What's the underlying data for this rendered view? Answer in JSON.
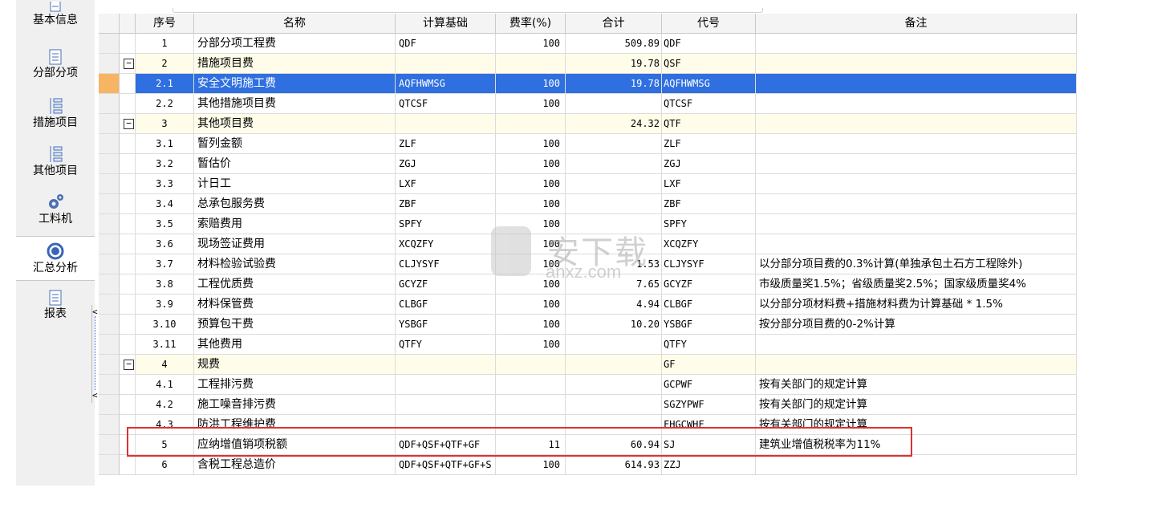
{
  "sidebar": {
    "items": [
      {
        "label": "基本信息",
        "icon": "document-icon"
      },
      {
        "label": "分部分项",
        "icon": "list-icon"
      },
      {
        "label": "措施项目",
        "icon": "tree-icon"
      },
      {
        "label": "其他项目",
        "icon": "tree-icon"
      },
      {
        "label": "工料机",
        "icon": "gears-icon"
      },
      {
        "label": "汇总分析",
        "icon": "circle-icon"
      },
      {
        "label": "报表",
        "icon": "report-icon"
      }
    ],
    "active": "汇总分析",
    "collapse_arrow": "<"
  },
  "columns": {
    "seq": "序号",
    "name": "名称",
    "basis": "计算基础",
    "rate": "费率(%)",
    "total": "合计",
    "code": "代号",
    "note": "备注"
  },
  "rows": [
    {
      "seq": "1",
      "name": "分部分项工程费",
      "basis": "QDF",
      "rate": "100",
      "total": "509.89",
      "code": "QDF",
      "note": ""
    },
    {
      "seq": "2",
      "name": "措施项目费",
      "basis": "",
      "rate": "",
      "total": "19.78",
      "code": "QSF",
      "note": "",
      "group": true,
      "toggle": "−"
    },
    {
      "seq": "2.1",
      "name": "安全文明施工费",
      "basis": "AQFHWMSG",
      "rate": "100",
      "total": "19.78",
      "code": "AQFHWMSG",
      "note": "",
      "selected": true
    },
    {
      "seq": "2.2",
      "name": "其他措施项目费",
      "basis": "QTCSF",
      "rate": "100",
      "total": "",
      "code": "QTCSF",
      "note": ""
    },
    {
      "seq": "3",
      "name": "其他项目费",
      "basis": "",
      "rate": "",
      "total": "24.32",
      "code": "QTF",
      "note": "",
      "group": true,
      "toggle": "−"
    },
    {
      "seq": "3.1",
      "name": "暂列金额",
      "basis": "ZLF",
      "rate": "100",
      "total": "",
      "code": "ZLF",
      "note": ""
    },
    {
      "seq": "3.2",
      "name": "暂估价",
      "basis": "ZGJ",
      "rate": "100",
      "total": "",
      "code": "ZGJ",
      "note": ""
    },
    {
      "seq": "3.3",
      "name": "计日工",
      "basis": "LXF",
      "rate": "100",
      "total": "",
      "code": "LXF",
      "note": ""
    },
    {
      "seq": "3.4",
      "name": "总承包服务费",
      "basis": "ZBF",
      "rate": "100",
      "total": "",
      "code": "ZBF",
      "note": ""
    },
    {
      "seq": "3.5",
      "name": "索赔费用",
      "basis": "SPFY",
      "rate": "100",
      "total": "",
      "code": "SPFY",
      "note": ""
    },
    {
      "seq": "3.6",
      "name": "现场签证费用",
      "basis": "XCQZFY",
      "rate": "100",
      "total": "",
      "code": "XCQZFY",
      "note": ""
    },
    {
      "seq": "3.7",
      "name": "材料检验试验费",
      "basis": "CLJYSYF",
      "rate": "100",
      "total": "1.53",
      "code": "CLJYSYF",
      "note": "以分部分项目费的0.3%计算(单独承包土石方工程除外)"
    },
    {
      "seq": "3.8",
      "name": "工程优质费",
      "basis": "GCYZF",
      "rate": "100",
      "total": "7.65",
      "code": "GCYZF",
      "note": "市级质量奖1.5%；省级质量奖2.5%；国家级质量奖4%"
    },
    {
      "seq": "3.9",
      "name": "材料保管费",
      "basis": "CLBGF",
      "rate": "100",
      "total": "4.94",
      "code": "CLBGF",
      "note": "以分部分项材料费+措施材料费为计算基础 * 1.5%"
    },
    {
      "seq": "3.10",
      "name": "预算包干费",
      "basis": "YSBGF",
      "rate": "100",
      "total": "10.20",
      "code": "YSBGF",
      "note": "按分部分项目费的0-2%计算"
    },
    {
      "seq": "3.11",
      "name": "其他费用",
      "basis": "QTFY",
      "rate": "100",
      "total": "",
      "code": "QTFY",
      "note": ""
    },
    {
      "seq": "4",
      "name": "规费",
      "basis": "",
      "rate": "",
      "total": "",
      "code": "GF",
      "note": "",
      "group": true,
      "toggle": "−"
    },
    {
      "seq": "4.1",
      "name": "工程排污费",
      "basis": "",
      "rate": "",
      "total": "",
      "code": "GCPWF",
      "note": "按有关部门的规定计算"
    },
    {
      "seq": "4.2",
      "name": "施工噪音排污费",
      "basis": "",
      "rate": "",
      "total": "",
      "code": "SGZYPWF",
      "note": "按有关部门的规定计算"
    },
    {
      "seq": "4.3",
      "name": "防洪工程维护费",
      "basis": "",
      "rate": "",
      "total": "",
      "code": "FHGCWHF",
      "note": "按有关部门的规定计算"
    },
    {
      "seq": "5",
      "name": "应纳增值销项税额",
      "basis": "QDF+QSF+QTF+GF",
      "rate": "11",
      "total": "60.94",
      "code": "SJ",
      "note": "建筑业增值税税率为11%"
    },
    {
      "seq": "6",
      "name": "含税工程总造价",
      "basis": "QDF+QSF+QTF+GF+S",
      "rate": "100",
      "total": "614.93",
      "code": "ZZJ",
      "note": ""
    }
  ],
  "watermark": {
    "text": "安下载",
    "url": "anxz.com",
    "shield": "安"
  },
  "colors": {
    "selected": "#2f6fe0",
    "group_row": "#fffde9",
    "highlight": "#e03030",
    "indicator": "#f7b463"
  }
}
